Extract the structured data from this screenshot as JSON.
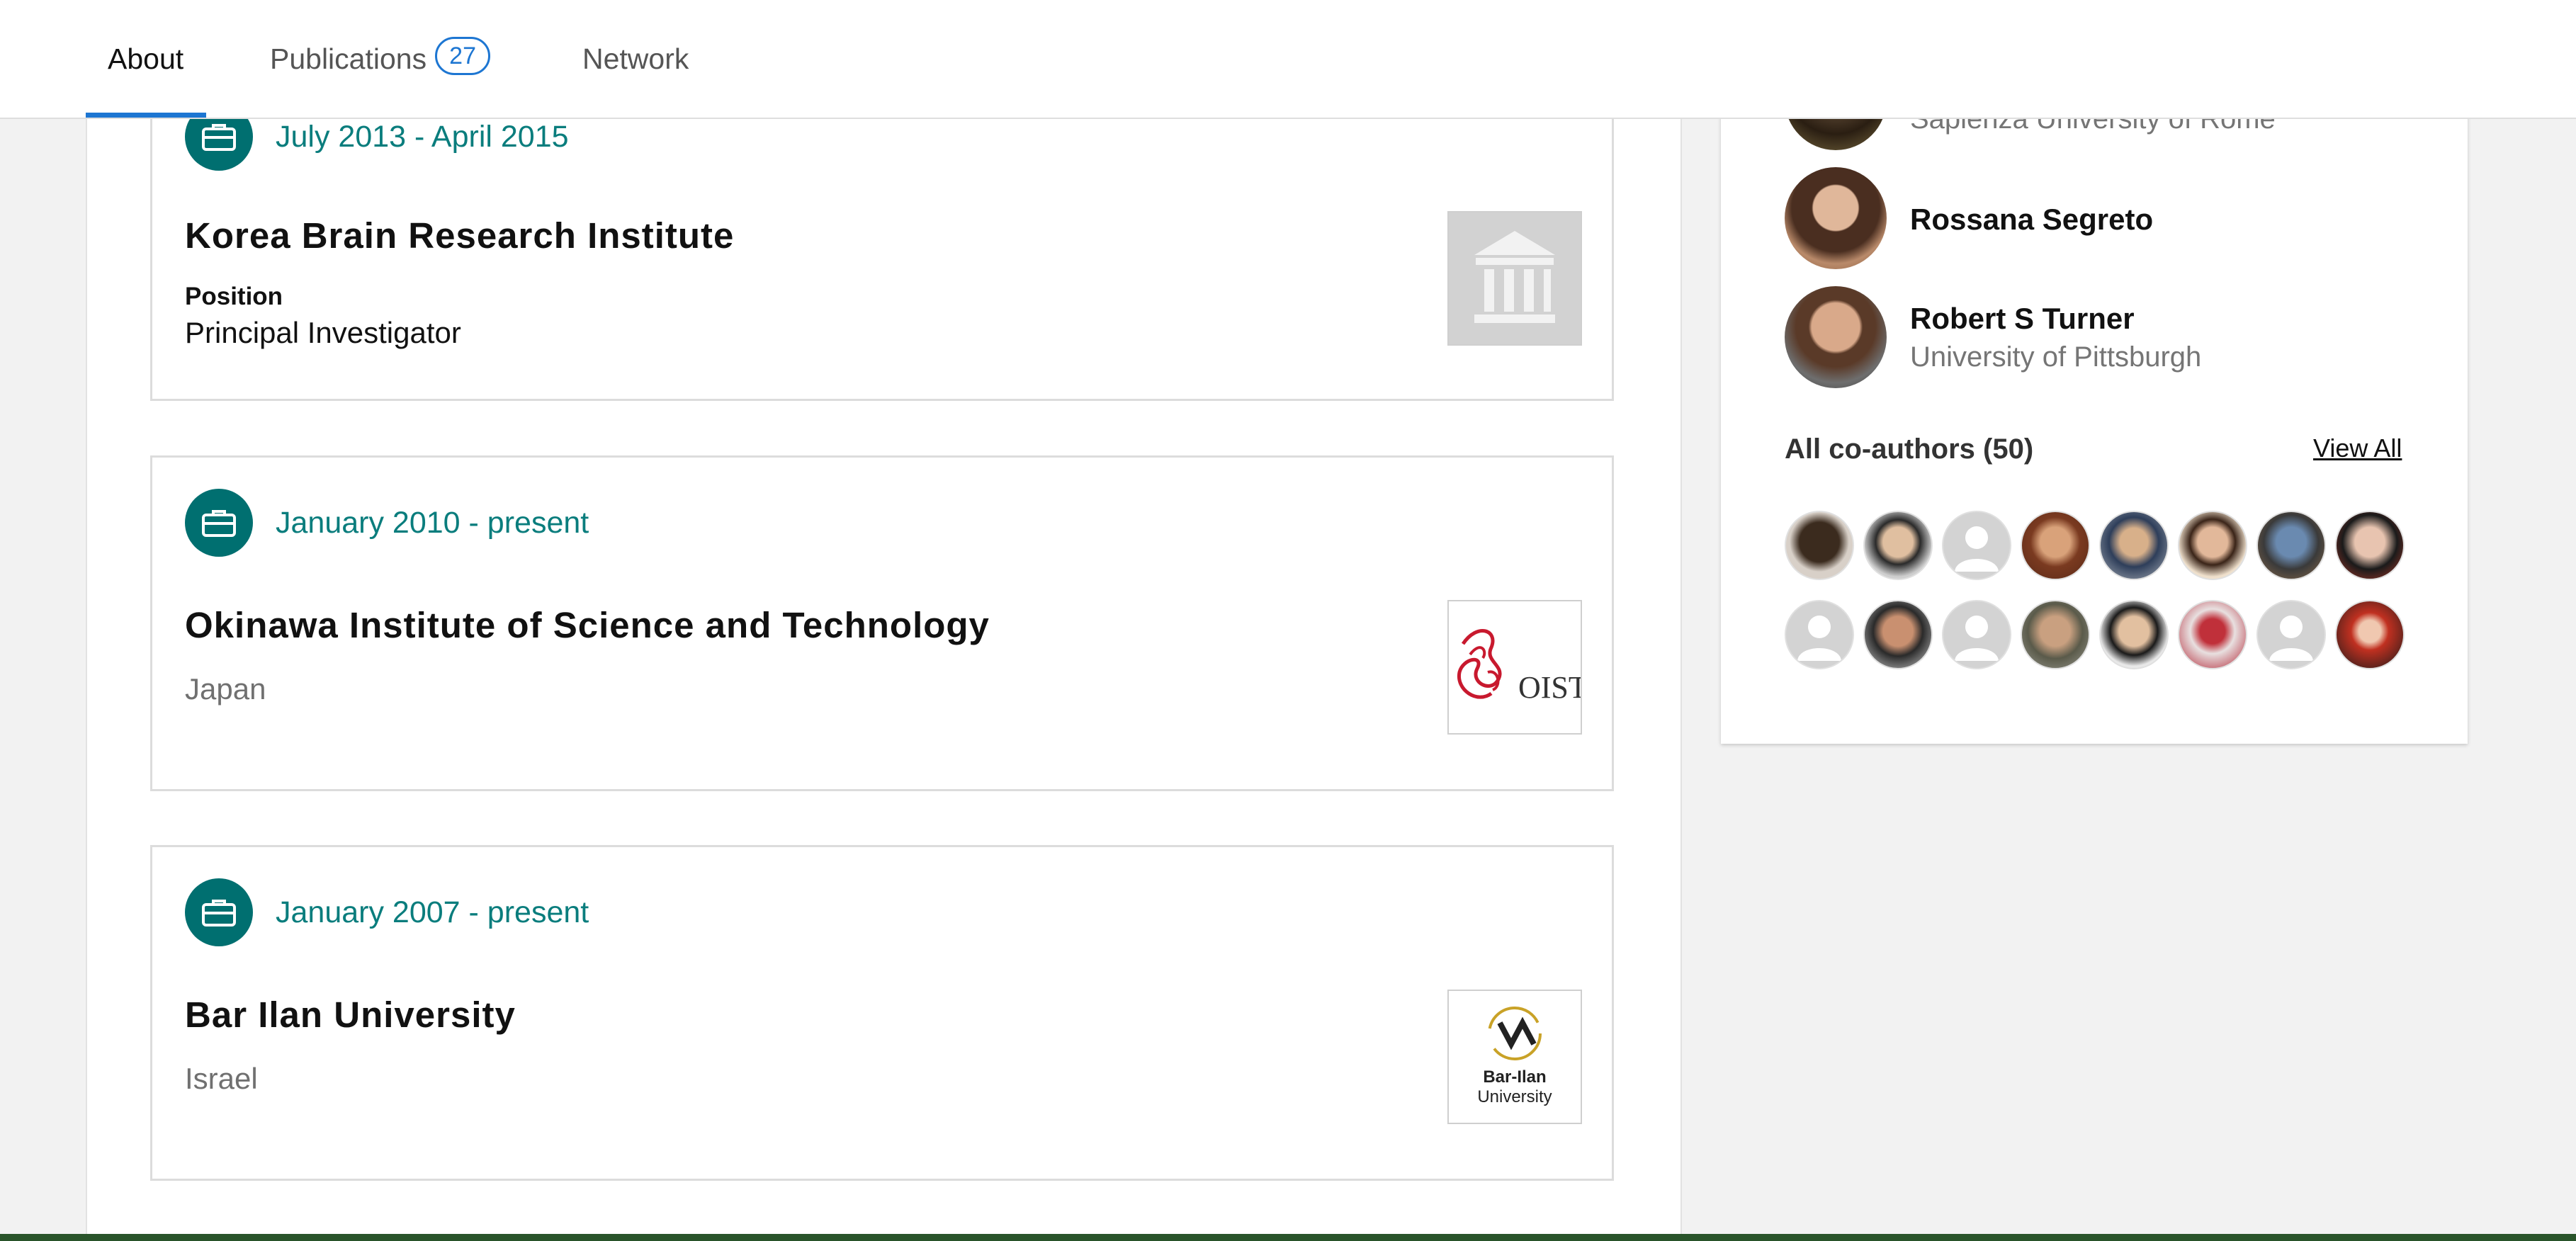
{
  "tabs": {
    "about": "About",
    "publications": "Publications",
    "publications_count": "27",
    "network": "Network"
  },
  "experience": [
    {
      "dates": "July 2013 - April 2015",
      "institution": "Korea Brain Research Institute",
      "position_label": "Position",
      "position": "Principal Investigator",
      "logo": "institution-building-icon"
    },
    {
      "dates": "January 2010 - present",
      "institution": "Okinawa Institute of Science and Technology",
      "location": "Japan",
      "logo_text": "OIST"
    },
    {
      "dates": "January 2007 - present",
      "institution": "Bar Ilan University",
      "location": "Israel",
      "logo_line1": "Bar-Ilan",
      "logo_line2": "University"
    }
  ],
  "sidebar": {
    "people": [
      {
        "name": "",
        "affiliation": "Sapienza University of Rome"
      },
      {
        "name": "Rossana Segreto",
        "affiliation": ""
      },
      {
        "name": "Robert S Turner",
        "affiliation": "University of Pittsburgh"
      }
    ],
    "coauthors_title": "All co-authors (50)",
    "view_all": "View All",
    "coauthor_avatars": [
      "photo",
      "photo",
      "placeholder",
      "photo",
      "photo",
      "photo",
      "photo",
      "photo",
      "placeholder",
      "photo",
      "placeholder",
      "photo",
      "photo",
      "photo",
      "placeholder",
      "photo"
    ]
  },
  "colors": {
    "accent_blue": "#1d76d2",
    "teal": "#006f70",
    "teal_text": "#0a7d7d",
    "footer_green": "#29542a"
  }
}
